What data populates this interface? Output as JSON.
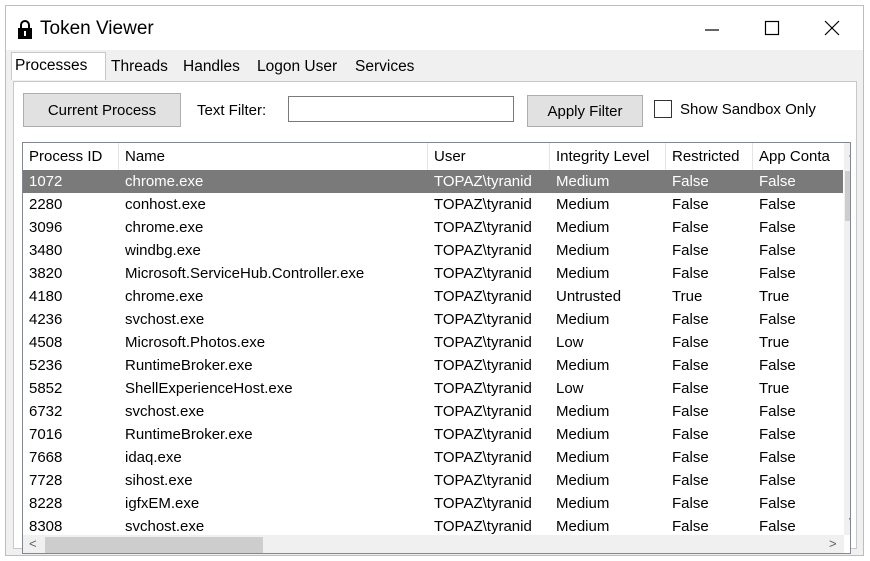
{
  "window": {
    "title": "Token Viewer"
  },
  "icons": {
    "app": "lock-icon",
    "minimize": "minimize-icon",
    "maximize": "maximize-icon",
    "close": "close-icon"
  },
  "tabs": [
    {
      "label": "Processes",
      "active": true
    },
    {
      "label": "Threads",
      "active": false
    },
    {
      "label": "Handles",
      "active": false
    },
    {
      "label": "Logon User",
      "active": false
    },
    {
      "label": "Services",
      "active": false
    }
  ],
  "toolbar": {
    "current_process_label": "Current Process",
    "text_filter_label": "Text Filter:",
    "text_filter_value": "",
    "apply_filter_label": "Apply Filter",
    "sandbox_label": "Show Sandbox Only",
    "sandbox_checked": false
  },
  "table": {
    "columns": [
      "Process ID",
      "Name",
      "User",
      "Integrity Level",
      "Restricted",
      "App Conta"
    ],
    "rows": [
      [
        "1072",
        "chrome.exe",
        "TOPAZ\\tyranid",
        "Medium",
        "False",
        "False"
      ],
      [
        "2280",
        "conhost.exe",
        "TOPAZ\\tyranid",
        "Medium",
        "False",
        "False"
      ],
      [
        "3096",
        "chrome.exe",
        "TOPAZ\\tyranid",
        "Medium",
        "False",
        "False"
      ],
      [
        "3480",
        "windbg.exe",
        "TOPAZ\\tyranid",
        "Medium",
        "False",
        "False"
      ],
      [
        "3820",
        "Microsoft.ServiceHub.Controller.exe",
        "TOPAZ\\tyranid",
        "Medium",
        "False",
        "False"
      ],
      [
        "4180",
        "chrome.exe",
        "TOPAZ\\tyranid",
        "Untrusted",
        "True",
        "True"
      ],
      [
        "4236",
        "svchost.exe",
        "TOPAZ\\tyranid",
        "Medium",
        "False",
        "False"
      ],
      [
        "4508",
        "Microsoft.Photos.exe",
        "TOPAZ\\tyranid",
        "Low",
        "False",
        "True"
      ],
      [
        "5236",
        "RuntimeBroker.exe",
        "TOPAZ\\tyranid",
        "Medium",
        "False",
        "False"
      ],
      [
        "5852",
        "ShellExperienceHost.exe",
        "TOPAZ\\tyranid",
        "Low",
        "False",
        "True"
      ],
      [
        "6732",
        "svchost.exe",
        "TOPAZ\\tyranid",
        "Medium",
        "False",
        "False"
      ],
      [
        "7016",
        "RuntimeBroker.exe",
        "TOPAZ\\tyranid",
        "Medium",
        "False",
        "False"
      ],
      [
        "7668",
        "idaq.exe",
        "TOPAZ\\tyranid",
        "Medium",
        "False",
        "False"
      ],
      [
        "7728",
        "sihost.exe",
        "TOPAZ\\tyranid",
        "Medium",
        "False",
        "False"
      ],
      [
        "8228",
        "igfxEM.exe",
        "TOPAZ\\tyranid",
        "Medium",
        "False",
        "False"
      ],
      [
        "8308",
        "svchost.exe",
        "TOPAZ\\tyranid",
        "Medium",
        "False",
        "False"
      ]
    ],
    "selected_row": 0
  },
  "scrollbars": {
    "up": "^",
    "down": "v",
    "left": "<",
    "right": ">"
  }
}
